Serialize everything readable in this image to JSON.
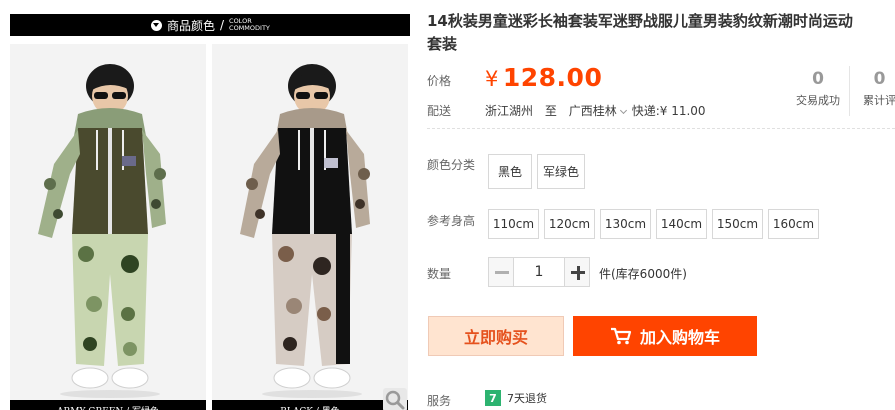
{
  "gallery": {
    "header_zh": "商品颜色",
    "header_sep": "/",
    "header_en_line1": "COLOR",
    "header_en_line2": "COMMODITY",
    "left_caption": "ARMY GREEN / 军绿色",
    "right_caption": "BLACK / 黑色",
    "zoom_icon": "magnifier-icon"
  },
  "product": {
    "title_line1": "14秋装男童迷彩长袖套装军迷野战服儿童男装豹纹新潮时尚运动",
    "title_line2": "套装"
  },
  "price": {
    "label": "价格",
    "currency": "¥",
    "value": "128.00",
    "accent_color": "#ff4400"
  },
  "shipping": {
    "label": "配送",
    "from": "浙江湖州",
    "to_word": "至",
    "to": "广西桂林",
    "fee": "快递:¥ 11.00"
  },
  "stats": {
    "deals_count": "0",
    "deals_label": "交易成功",
    "reviews_count": "0",
    "reviews_label": "累计评"
  },
  "colors": {
    "label": "颜色分类",
    "options": [
      "黑色",
      "军绿色"
    ]
  },
  "sizes": {
    "label": "参考身高",
    "options": [
      "110cm",
      "120cm",
      "130cm",
      "140cm",
      "150cm",
      "160cm"
    ]
  },
  "quantity": {
    "label": "数量",
    "value": "1",
    "stock": "件(库存6000件)"
  },
  "actions": {
    "buy_now": "立即购买",
    "add_to_cart": "加入购物车",
    "cart_icon": "cart-icon"
  },
  "service": {
    "label": "服务",
    "badge": "7",
    "text": "7天退货",
    "badge_color": "#2db370"
  }
}
